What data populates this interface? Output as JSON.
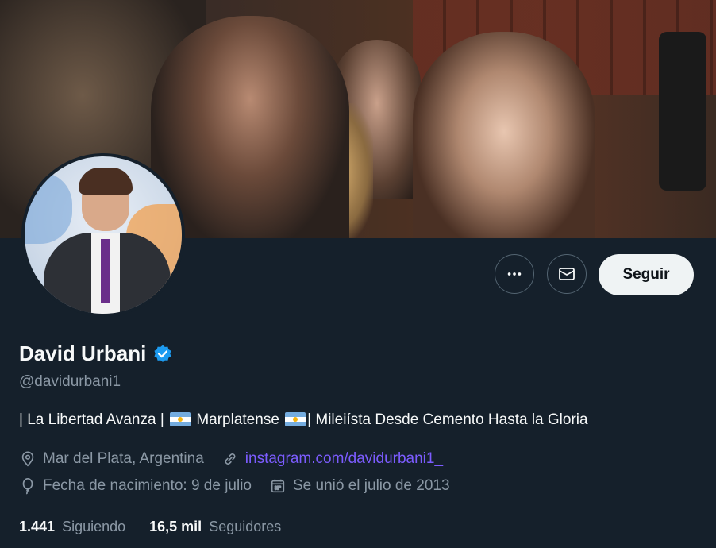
{
  "profile": {
    "name": "David Urbani",
    "handle": "@davidurbani1",
    "bio": {
      "part1": "| La Libertad Avanza |",
      "part2": "Marplatense",
      "part3": "| Mileiísta Desde Cemento Hasta la Gloria"
    },
    "location": "Mar del Plata, Argentina",
    "website": "instagram.com/davidurbani1_",
    "birthday": "Fecha de nacimiento: 9 de julio",
    "joined": "Se unió el julio de 2013"
  },
  "actions": {
    "follow_label": "Seguir"
  },
  "stats": {
    "following_count": "1.441",
    "following_label": "Siguiendo",
    "followers_count": "16,5 mil",
    "followers_label": "Seguidores"
  },
  "colors": {
    "background": "#15202b",
    "secondary_text": "#8b98a5",
    "verified": "#1d9bf0",
    "link": "#7c5cff"
  },
  "icons": {
    "more": "more-icon",
    "message": "mail-icon",
    "verified": "verified-badge-icon",
    "location": "location-icon",
    "link": "link-icon",
    "birthday": "balloon-icon",
    "calendar": "calendar-icon",
    "flag": "argentina-flag-icon"
  }
}
